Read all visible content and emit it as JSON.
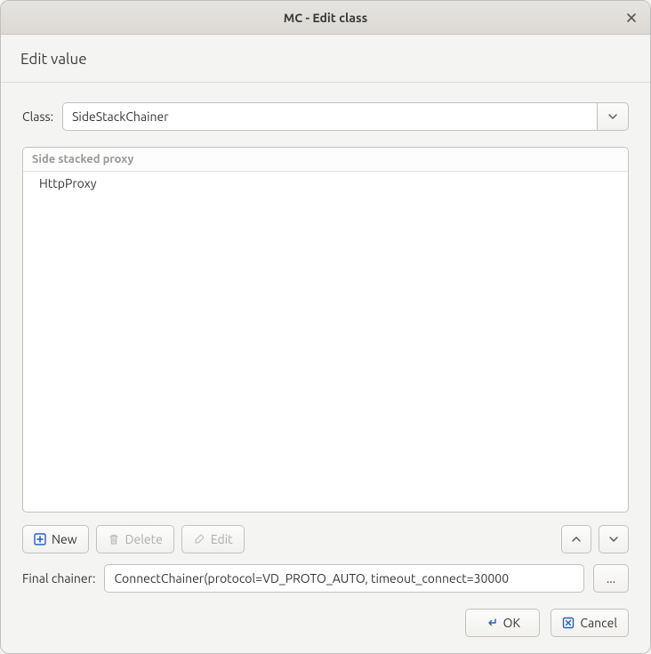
{
  "window": {
    "title": "MC - Edit class"
  },
  "header": {
    "title": "Edit value"
  },
  "class_field": {
    "label": "Class:",
    "value": "SideStackChainer"
  },
  "proxy_list": {
    "header": "Side stacked proxy",
    "items": [
      "HttpProxy"
    ]
  },
  "toolbar": {
    "new_label": "New",
    "delete_label": "Delete",
    "edit_label": "Edit"
  },
  "final_chainer": {
    "label": "Final chainer:",
    "value": "ConnectChainer(protocol=VD_PROTO_AUTO, timeout_connect=30000",
    "browse_label": "..."
  },
  "footer": {
    "ok_label": "OK",
    "cancel_label": "Cancel"
  }
}
